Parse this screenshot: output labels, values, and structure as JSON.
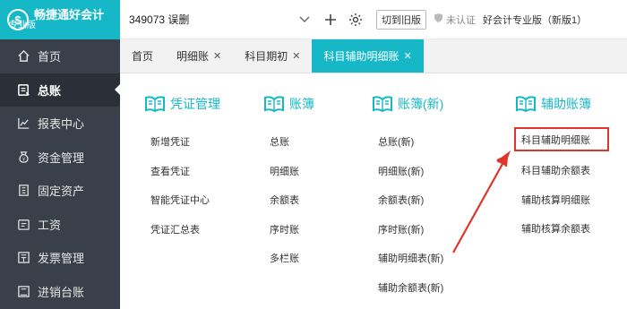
{
  "brand": {
    "logo_glyph": "$",
    "name": "畅捷通好会计",
    "sub": "专业版"
  },
  "sidebar": {
    "items": [
      {
        "label": "首页",
        "icon": "home-icon",
        "active": false
      },
      {
        "label": "总账",
        "icon": "ledger-icon",
        "active": true
      },
      {
        "label": "报表中心",
        "icon": "chart-icon",
        "active": false
      },
      {
        "label": "资金管理",
        "icon": "money-bag-icon",
        "active": false
      },
      {
        "label": "固定资产",
        "icon": "asset-icon",
        "active": false
      },
      {
        "label": "工资",
        "icon": "wallet-icon",
        "active": false
      },
      {
        "label": "发票管理",
        "icon": "invoice-icon",
        "active": false
      },
      {
        "label": "进销台账",
        "icon": "register-icon",
        "active": false
      }
    ]
  },
  "topbar": {
    "account": "349073 误删",
    "switch_old": "切到旧版",
    "unverified": "未认证",
    "edition": "好会计专业版（新版1）"
  },
  "tabs": [
    {
      "label": "首页",
      "closable": false
    },
    {
      "label": "明细账",
      "closable": true
    },
    {
      "label": "科目期初",
      "closable": true
    },
    {
      "label": "科目辅助明细账",
      "closable": true,
      "active": true
    }
  ],
  "columns": [
    {
      "title": "凭证管理",
      "items": [
        "新增凭证",
        "查看凭证",
        "智能凭证中心",
        "凭证汇总表"
      ]
    },
    {
      "title": "账簿",
      "items": [
        "总账",
        "明细账",
        "余额表",
        "序时账",
        "多栏账"
      ]
    },
    {
      "title": "账簿(新)",
      "items": [
        "总账(新)",
        "明细账(新)",
        "余额表(新)",
        "序时账(新)",
        "辅助明细表(新)",
        "辅助余额表(新)"
      ]
    },
    {
      "title": "辅助账簿",
      "items": [
        "科目辅助明细账",
        "科目辅助余额表",
        "辅助核算明细账",
        "辅助核算余额表"
      ]
    }
  ],
  "colors": {
    "accent": "#16b8c7",
    "sidebar_bg": "#3a4049",
    "highlight_red": "#e0352b"
  }
}
